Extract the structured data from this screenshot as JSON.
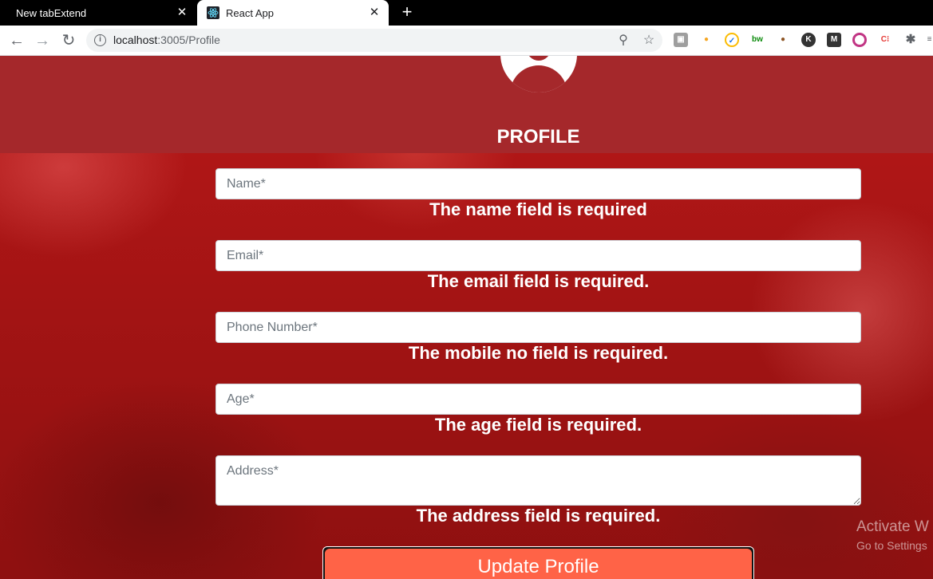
{
  "browser": {
    "tabs": [
      {
        "title": "New tabExtend"
      },
      {
        "title": "React App"
      }
    ],
    "url_host": "localhost",
    "url_path": ":3005/Profile"
  },
  "profile": {
    "title": "PROFILE",
    "fields": {
      "name": {
        "placeholder": "Name*",
        "error": "The name field is required"
      },
      "email": {
        "placeholder": "Email*",
        "error": "The email field is required."
      },
      "phone": {
        "placeholder": "Phone Number*",
        "error": "The mobile no field is required."
      },
      "age": {
        "placeholder": "Age*",
        "error": "The age field is required."
      },
      "address": {
        "placeholder": "Address*",
        "error": "The address field is required."
      }
    },
    "submit_label": "Update Profile"
  },
  "watermark": {
    "line1": "Activate W",
    "line2": "Go to Settings"
  },
  "icons": [
    "close-icon",
    "plus-icon",
    "back-arrow-icon",
    "forward-arrow-icon",
    "reload-icon",
    "info-icon",
    "zoom-icon",
    "star-icon",
    "puzzle-icon",
    "user-icon"
  ]
}
